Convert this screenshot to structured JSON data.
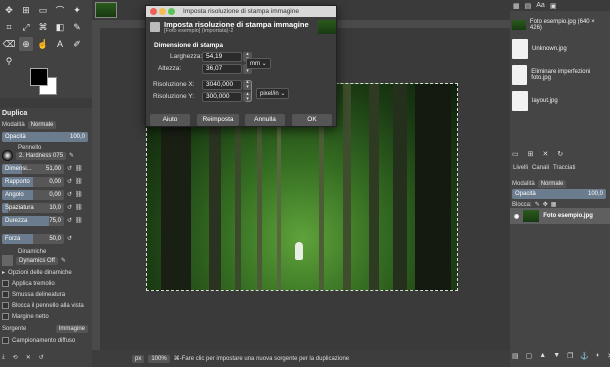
{
  "toolbox": {
    "tools": [
      "move-icon",
      "align-icon",
      "rect-select-icon",
      "free-select-icon",
      "fuzzy-select-icon",
      "crop-icon",
      "unified-transform-icon",
      "warp-icon",
      "gradient-icon",
      "paintbrush-icon",
      "eraser-icon",
      "clone-icon",
      "smudge-icon",
      "text-icon",
      "color-picker-icon",
      "zoom-icon"
    ],
    "panel_title": "Duplica",
    "mode_label": "Modalità",
    "mode_value": "Normale",
    "opacity_label": "Opacità",
    "opacity_value": "100,0",
    "brush_label": "Pennello",
    "brush_value": "2. Hardness 075",
    "size_label": "Dimensi...",
    "size_value": "51,00",
    "ratio_label": "Rapporto",
    "ratio_value": "0,00",
    "angle_label": "Angolo",
    "angle_value": "0,00",
    "spacing_label": "Spaziatura",
    "spacing_value": "10,0",
    "hardness_label": "Durezza",
    "hardness_value": "75,0",
    "force_label": "Forza",
    "force_value": "50,0",
    "dynamics_label": "Dinamiche",
    "dynamics_value": "Dynamics Off",
    "dyn_options": "Opzioni delle dinamiche",
    "jitter": "Applica tremolio",
    "smooth": "Smussa delineatura",
    "lock_brush": "Blocca il pennello alla vista",
    "edge_only": "Margine netto",
    "source_label": "Sorgente",
    "source_value": "Immagine",
    "sample_merged": "Campionamento diffuso"
  },
  "status": {
    "unit": "px",
    "zoom": "100%",
    "hint": "⌘-Fare clic per impostare una nuova sorgente per la duplicazione"
  },
  "dialog": {
    "window_title": "Imposta risoluzione di stampa immagine",
    "title": "Imposta risoluzione di stampa immagine",
    "subtitle": "[Foto esempio] (importata)-2",
    "section": "Dimensione di stampa",
    "width_label": "Larghezza:",
    "width_value": "54,19",
    "height_label": "Altezza:",
    "height_value": "36,07",
    "size_unit": "mm",
    "resx_label": "Risoluzione X:",
    "resx_value": "3040,000",
    "resy_label": "Risoluzione Y:",
    "resy_value": "300,000",
    "res_unit": "pixel/in",
    "btn_help": "Aiuto",
    "btn_reset": "Reimposta",
    "btn_cancel": "Annulla",
    "btn_ok": "OK"
  },
  "right": {
    "images": [
      {
        "name": "Foto esempio.jpg (640 × 426)"
      },
      {
        "name": "Unknown.jpg"
      },
      {
        "name": "Eliminare imperfezioni foto.jpg"
      },
      {
        "name": "layout.jpg"
      }
    ],
    "tabs": [
      "Livelli",
      "Canali",
      "Tracciati"
    ],
    "mode_label": "Modalità",
    "mode_value": "Normale",
    "opacity_label": "Opacità",
    "opacity_value": "100,0",
    "lock_label": "Blocca:",
    "layer_name": "Foto esempio.jpg"
  }
}
